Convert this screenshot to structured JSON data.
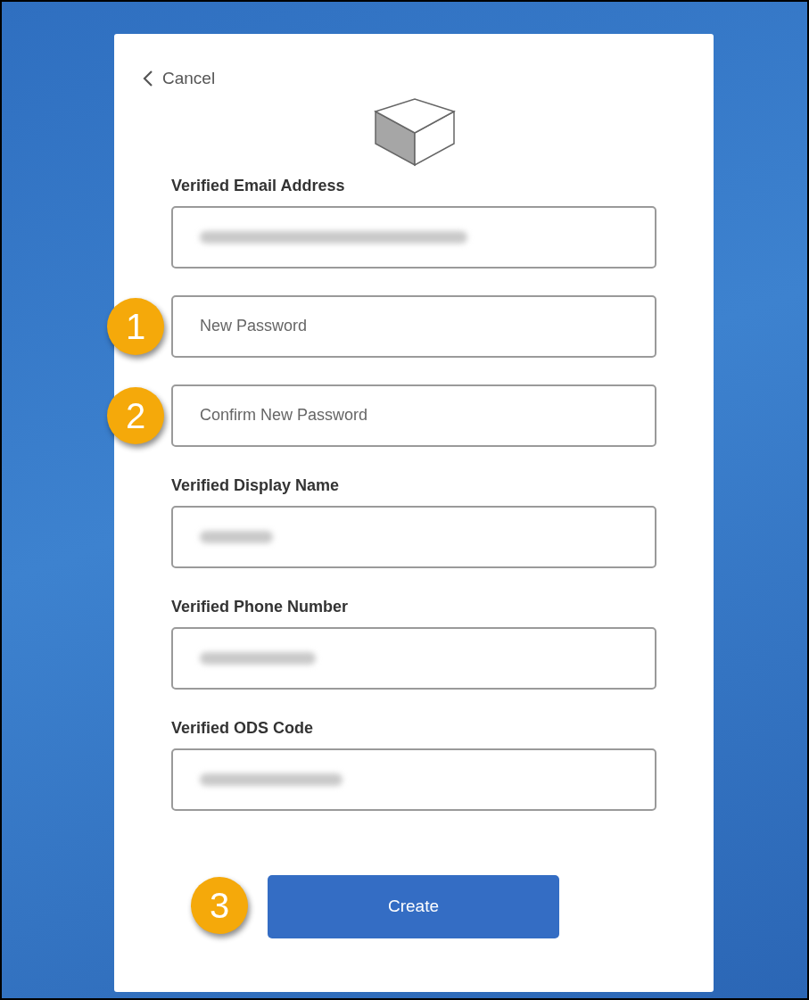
{
  "cancel": {
    "label": "Cancel"
  },
  "fields": [
    {
      "kind": "verified",
      "label": "Verified Email Address",
      "blurred": true
    },
    {
      "kind": "entry",
      "placeholder": "New Password",
      "callout": "1"
    },
    {
      "kind": "entry",
      "placeholder": "Confirm New Password",
      "callout": "2"
    },
    {
      "kind": "verified",
      "label": "Verified Display Name",
      "blurred": true
    },
    {
      "kind": "verified",
      "label": "Verified Phone Number",
      "blurred": true
    },
    {
      "kind": "verified",
      "label": "Verified ODS Code",
      "blurred": true
    }
  ],
  "submit": {
    "label": "Create",
    "callout": "3"
  }
}
